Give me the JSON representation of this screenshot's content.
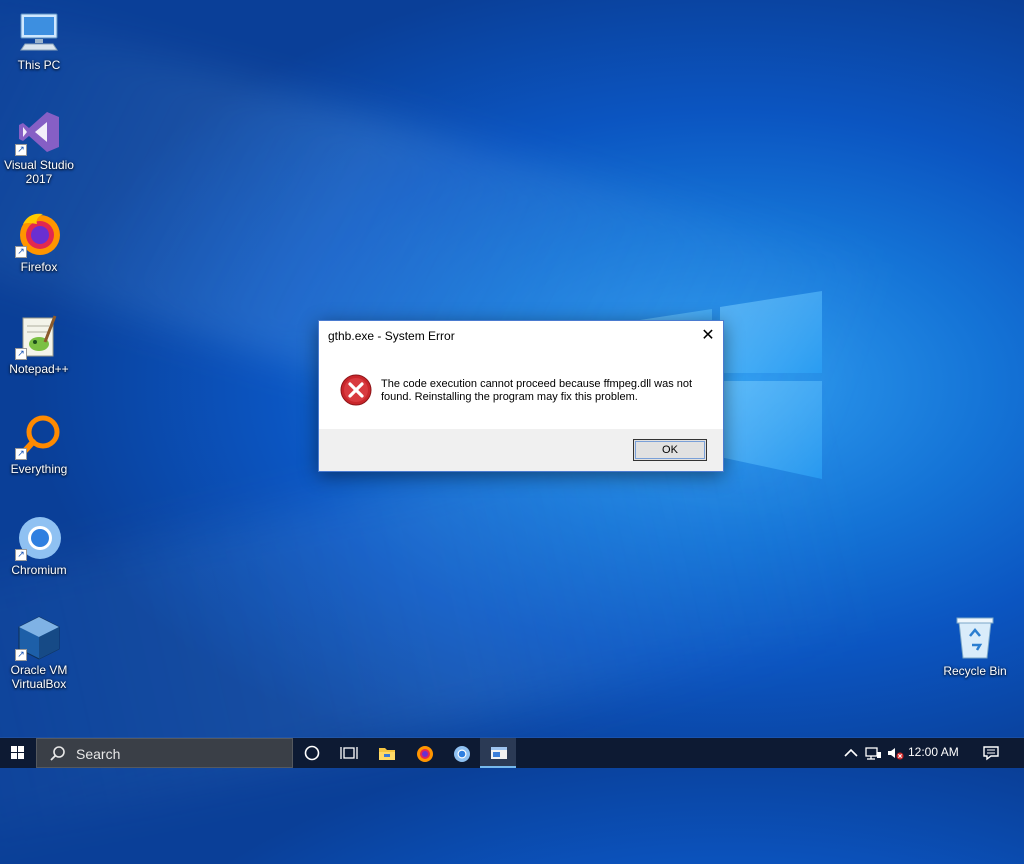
{
  "desktop": {
    "icons": [
      {
        "label_line1": "This PC",
        "label_line2": "",
        "icon": "computer-icon"
      },
      {
        "label_line1": "Visual Studio",
        "label_line2": "2017",
        "icon": "visual-studio-icon"
      },
      {
        "label_line1": "Firefox",
        "label_line2": "",
        "icon": "firefox-icon"
      },
      {
        "label_line1": "Notepad++",
        "label_line2": "",
        "icon": "notepad-plus-plus-icon"
      },
      {
        "label_line1": "Everything",
        "label_line2": "",
        "icon": "everything-search-icon"
      },
      {
        "label_line1": "Chromium",
        "label_line2": "",
        "icon": "chromium-icon"
      },
      {
        "label_line1": "Oracle VM",
        "label_line2": "VirtualBox",
        "icon": "virtualbox-icon"
      },
      {
        "label_line1": "Recycle Bin",
        "label_line2": "",
        "icon": "recycle-bin-icon"
      }
    ]
  },
  "dialog": {
    "title": "gthb.exe - System Error",
    "message": "The code execution cannot proceed because ffmpeg.dll was not found. Reinstalling the program may fix this problem.",
    "ok_label": "OK",
    "close_glyph": "✕",
    "icon": "error-icon"
  },
  "taskbar": {
    "search_label": "Search",
    "pinned": [
      "task-view",
      "file-explorer",
      "firefox",
      "chromium",
      "active-window"
    ],
    "clock": "12:00 AM"
  },
  "colors": {
    "desktop_accent": "#1473d6",
    "taskbar": "#0d1a33",
    "error_red": "#c9262b"
  }
}
